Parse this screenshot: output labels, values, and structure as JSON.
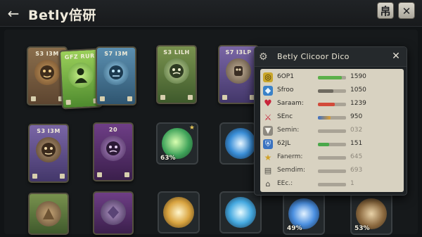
{
  "header": {
    "title": "Betly倍研",
    "back_icon": "←",
    "lock_button": "帛",
    "close_button": "✕"
  },
  "cards": [
    {
      "label": "S3 I3M"
    },
    {
      "label": "GFZ RUR"
    },
    {
      "label": "S7 I3M"
    },
    {
      "label": "S3 LILH"
    },
    {
      "label": "S7 I3LP"
    },
    {
      "label": "S3 I3M"
    },
    {
      "label": "20"
    }
  ],
  "tiles": [
    {
      "pct": "63%"
    },
    {
      "pct": "49%"
    },
    {
      "pct": "53%"
    }
  ],
  "popup": {
    "title": "Betly Clicoor Dico",
    "close": "✕",
    "stats": [
      {
        "label": "6OP1",
        "value": "1590",
        "icon": "coin-icon"
      },
      {
        "label": "Sfroo",
        "value": "1050",
        "icon": "diamond-icon"
      },
      {
        "label": "Saraam:",
        "value": "1239",
        "icon": "heart-icon"
      },
      {
        "label": "SEnc",
        "value": "950",
        "icon": "sword-icon"
      },
      {
        "label": "Semin:",
        "value": "032",
        "icon": "tooth-icon"
      },
      {
        "label": "62JL",
        "value": "151",
        "icon": "shield-icon"
      },
      {
        "label": "Fanerm:",
        "value": "645",
        "icon": "star-icon"
      },
      {
        "label": "Semdim:",
        "value": "693",
        "icon": "book-icon"
      },
      {
        "label": "EEc.:",
        "value": "1",
        "icon": "chair-icon"
      }
    ]
  }
}
